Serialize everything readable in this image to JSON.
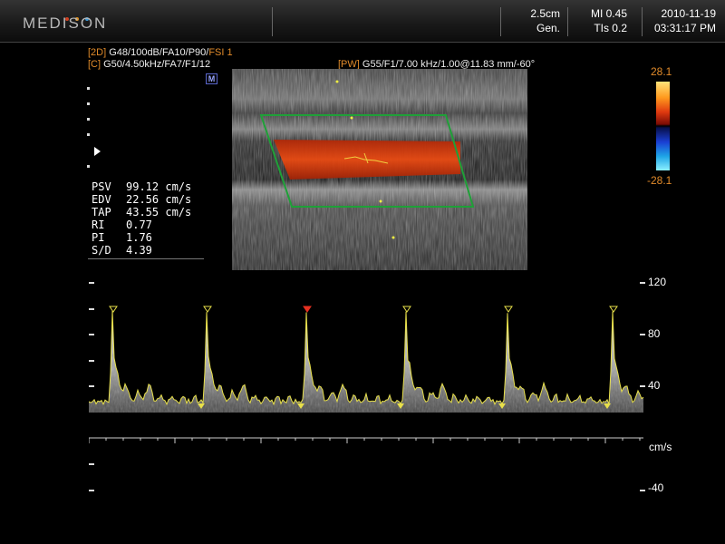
{
  "header": {
    "brand": "MEDISON",
    "depth": "2.5cm",
    "preset": "Gen.",
    "mi": "MI 0.45",
    "tis": "TIs 0.2",
    "date": "2010-11-19",
    "time": "03:31:17 PM"
  },
  "params": {
    "line1_mode": "[2D]",
    "line1_text": " G48/100dB/FA10/P90/",
    "line1_fsi": "FSI 1",
    "line2_mode": "[C]",
    "line2_text": " G50/4.50kHz/FA7/F1/12",
    "pw_mode": "[PW]",
    "pw_text": " G55/F1/7.00 kHz/1.00@11.83 mm/-60°",
    "m_marker": "M"
  },
  "measurements": [
    {
      "label": "PSV",
      "value": "99.12 cm/s"
    },
    {
      "label": "EDV",
      "value": "22.56 cm/s"
    },
    {
      "label": "TAP",
      "value": "43.55 cm/s"
    },
    {
      "label": "RI",
      "value": " 0.77"
    },
    {
      "label": "PI",
      "value": " 1.76"
    },
    {
      "label": "S/D",
      "value": " 4.39"
    }
  ],
  "color_scale": {
    "max": "28.1",
    "min": "-28.1"
  },
  "velocity_scale": {
    "labels": [
      "120",
      "80",
      "40",
      "cm/s",
      "-40"
    ],
    "unit": "cm/s"
  },
  "colors": {
    "accent_orange": "#e08a2a",
    "trace_yellow": "#e8e04a",
    "roi_green": "#1fa038",
    "selected_marker": "#e63020"
  },
  "icons": {
    "focus": "focus-marker-icon",
    "peak": "peak-marker-icon",
    "edv": "edv-marker-icon"
  }
}
